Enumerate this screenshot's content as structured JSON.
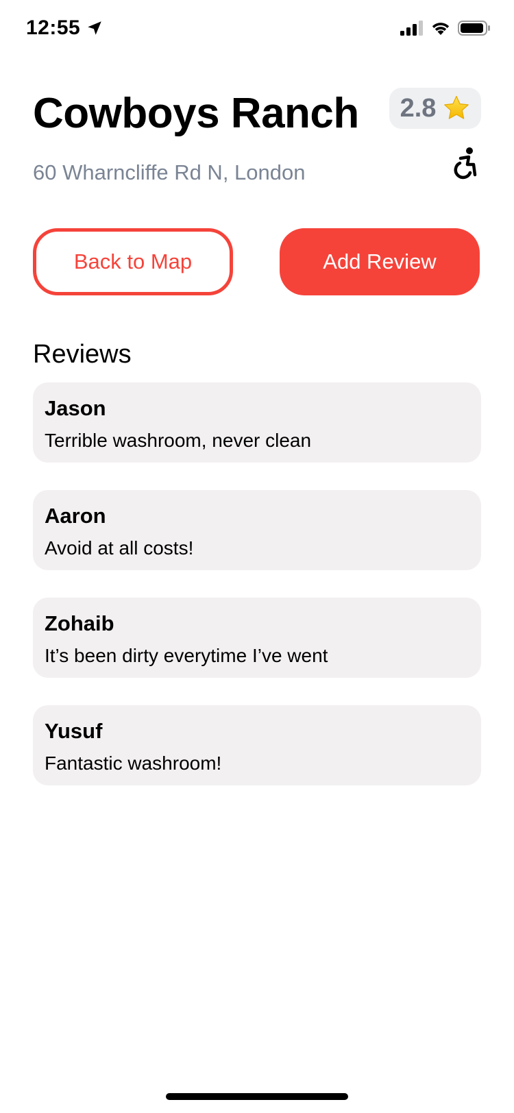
{
  "status_bar": {
    "time": "12:55"
  },
  "place": {
    "name": "Cowboys Ranch",
    "address": "60 Wharncliffe Rd N, London",
    "rating": "2.8"
  },
  "actions": {
    "back_label": "Back to Map",
    "add_review_label": "Add Review"
  },
  "reviews": {
    "heading": "Reviews",
    "items": [
      {
        "name": "Jason",
        "text": "Terrible washroom, never clean"
      },
      {
        "name": "Aaron",
        "text": "Avoid at all costs!"
      },
      {
        "name": "Zohaib",
        "text": "It’s been dirty everytime I’ve went"
      },
      {
        "name": "Yusuf",
        "text": "Fantastic washroom!"
      }
    ]
  },
  "icons": {
    "location": "location-arrow-icon",
    "signal": "cellular-signal-icon",
    "wifi": "wifi-icon",
    "battery": "battery-icon",
    "star": "star-icon",
    "accessibility": "wheelchair-accessible-icon"
  },
  "colors": {
    "accent": "#f5433a",
    "address": "#7a8494",
    "rating_text": "#6e7480",
    "rating_badge_bg": "#eef0f2",
    "card_bg": "#f3f0f1"
  }
}
